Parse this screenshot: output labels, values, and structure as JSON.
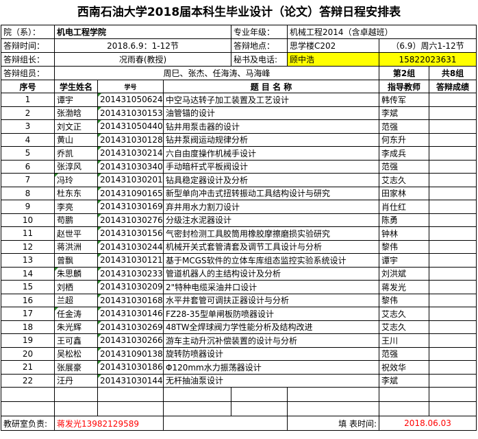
{
  "title": "西南石油大学2018届本科生毕业设计（论文）答辩日程安排表",
  "info": {
    "college_label": "院（系）：",
    "college_value": "机电工程学院",
    "major_label": "专业年级：",
    "major_value": "机械工程2014（含卓越班）",
    "time_label": "答辩时间：",
    "time_value": "2018.6.9：1-12节",
    "place_label": "答辩地点：",
    "place_value": "思学楼C202",
    "place_extra": "（6.9）周六1-12节",
    "leader_label": "答辩组长：",
    "leader_value": "况雨春(教授)",
    "secretary_label": "秘书及电话:",
    "secretary_name": "顾中浩",
    "secretary_phone": "15822023631",
    "members_label": "答辩组员：",
    "members_value": "周巳、张杰、任海涛、马海峰",
    "group_no": "第2组",
    "group_total": "共8组"
  },
  "columns": {
    "seq": "序号",
    "name": "学生姓名",
    "sid": "学号",
    "topic": "题 目 名 称",
    "advisor": "指导教师",
    "grade": "答辩成绩"
  },
  "rows": [
    {
      "seq": "1",
      "name": "谭宇",
      "sid": "201431050624",
      "topic": "中空马达转子加工装置及工艺设计",
      "advisor": "韩传军",
      "mark": false
    },
    {
      "seq": "2",
      "name": "张渤晗",
      "sid": "201431030153",
      "topic": "油管锚的设计",
      "advisor": "李斌",
      "mark": false
    },
    {
      "seq": "3",
      "name": "刘文正",
      "sid": "201431050440",
      "topic": "钻井用泵击器的设计",
      "advisor": "范强",
      "mark": false
    },
    {
      "seq": "4",
      "name": "黄山",
      "sid": "201431030128",
      "topic": "钻井泵阀运动规律分析",
      "advisor": "何东升",
      "mark": false
    },
    {
      "seq": "5",
      "name": "乔凯",
      "sid": "201431030214",
      "topic": "六自由度操作机械手设计",
      "advisor": "李成兵",
      "mark": false
    },
    {
      "seq": "6",
      "name": "张淳风",
      "sid": "201431030340",
      "topic": "手动暗杆式平板阀设计",
      "advisor": "范强",
      "mark": false
    },
    {
      "seq": "7",
      "name": "冯玲",
      "sid": "201431030201",
      "topic": "钻具稳定器设计及分析",
      "advisor": "艾志久",
      "mark": true
    },
    {
      "seq": "8",
      "name": "杜东东",
      "sid": "201431090165",
      "topic": "新型单向冲击式扭转振动工具结构设计与研究",
      "advisor": "田家林",
      "mark": false
    },
    {
      "seq": "9",
      "name": "李亮",
      "sid": "201431030169",
      "topic": "弃井用水力割刀设计",
      "advisor": "肖仕红",
      "mark": false
    },
    {
      "seq": "10",
      "name": "苟鹏",
      "sid": "201431030276",
      "topic": "分级注水泥器设计",
      "advisor": "陈勇",
      "mark": false
    },
    {
      "seq": "11",
      "name": "赵世平",
      "sid": "201431030156",
      "topic": "气密封检测工具胶筒用橡胶摩擦磨损实验研究",
      "advisor": "钟林",
      "mark": false
    },
    {
      "seq": "12",
      "name": "蒋洪洲",
      "sid": "201431030244",
      "topic": "机械开关式套管清套及调节工具设计与分析",
      "advisor": "黎伟",
      "mark": false
    },
    {
      "seq": "13",
      "name": "曾飘",
      "sid": "201431030121",
      "topic": "基于MCGS软件的立体车库组态监控实验系统设计",
      "advisor": "谭宇",
      "mark": false
    },
    {
      "seq": "14",
      "name": "朱思麟",
      "sid": "201431030233",
      "topic": "管道机器人的主结构设计及分析",
      "advisor": "刘洪斌",
      "mark": true
    },
    {
      "seq": "15",
      "name": "刘栖",
      "sid": "201431030209",
      "topic": "2\"特种电缆采油井口设计",
      "advisor": "蒋发光",
      "mark": false
    },
    {
      "seq": "16",
      "name": "兰超",
      "sid": "201431030168",
      "topic": "水平井套管可调扶正器设计与分析",
      "advisor": "黎伟",
      "mark": false
    },
    {
      "seq": "17",
      "name": "任金涛",
      "sid": "201431030146",
      "topic": "FZ28-35型单闸板防喷器设计",
      "advisor": "艾志久",
      "mark": true
    },
    {
      "seq": "18",
      "name": "朱光辉",
      "sid": "201431030269",
      "topic": "48TW全焊球阀力学性能分析及结构改进",
      "advisor": "艾志久",
      "mark": false
    },
    {
      "seq": "19",
      "name": "王可鑫",
      "sid": "201431030266",
      "topic": "游车主动升沉补偿装置的设计与分析",
      "advisor": "王川",
      "mark": false
    },
    {
      "seq": "20",
      "name": "吴松松",
      "sid": "201431090138",
      "topic": "旋转防喷器设计",
      "advisor": "范强",
      "mark": false
    },
    {
      "seq": "21",
      "name": "张展豪",
      "sid": "201431030186",
      "topic": "Φ120mm水力振荡器设计",
      "advisor": "祝效华",
      "mark": false
    },
    {
      "seq": "22",
      "name": "汪丹",
      "sid": "201431030144",
      "topic": "无杆抽油泵设计",
      "advisor": "李斌",
      "mark": false
    }
  ],
  "footer": {
    "office_label": "教研室负责:",
    "office_value": "蒋发光13982129589",
    "date_label": "填 表时间:",
    "date_value": "2018.06.03"
  }
}
